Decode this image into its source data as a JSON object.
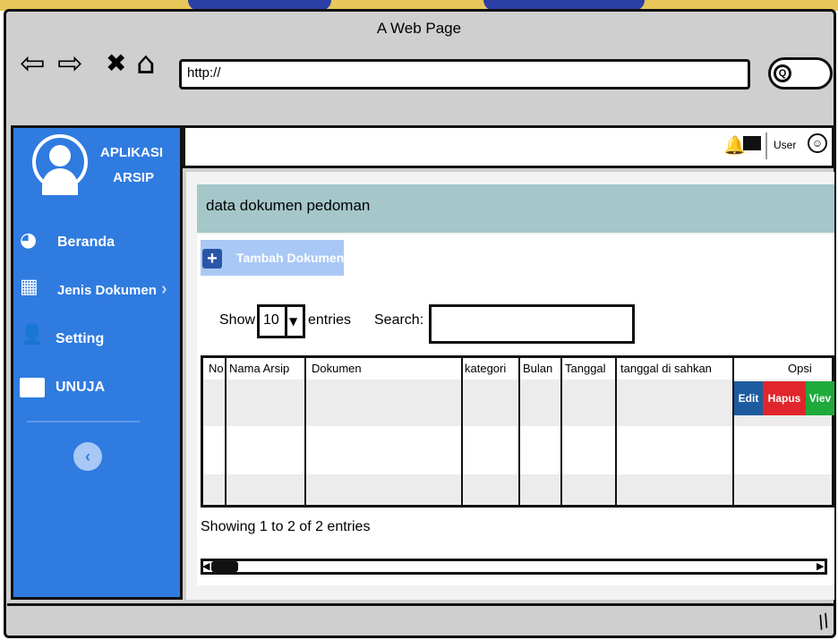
{
  "window": {
    "title": "A Web Page",
    "url": "http://",
    "nav_back": "⇦",
    "nav_forward": "⇨",
    "nav_stop": "✖",
    "nav_home": "⌂",
    "search_glyph": "Q"
  },
  "sidebar": {
    "brand_line1": "APLIKASI",
    "brand_line2": "ARSIP",
    "items": [
      {
        "label": "Beranda",
        "icon": "dashboard-icon",
        "glyph": "◕"
      },
      {
        "label": "Jenis Dokumen",
        "icon": "grid-icon",
        "glyph": "▦",
        "chevron": "›"
      },
      {
        "label": "Setting",
        "icon": "user-icon",
        "glyph": "👤"
      },
      {
        "label": "UNUJA",
        "icon": "folder-icon",
        "glyph": "▬"
      }
    ],
    "collapse_glyph": "‹"
  },
  "topbar": {
    "bell_glyph": "🔔",
    "user_label": "User",
    "user_glyph": "☺"
  },
  "panel": {
    "title": "data dokumen pedoman",
    "add_button": "Tambah Dokumen",
    "add_glyph": "+"
  },
  "table_controls": {
    "show_label": "Show",
    "page_size": "10",
    "caret": "▼",
    "entries_label": "entries",
    "search_label": "Search:"
  },
  "table": {
    "columns": [
      "No",
      "Nama Arsip",
      "Dokumen",
      "kategori",
      "Bulan",
      "Tanggal",
      "tanggal di sahkan",
      "Opsi"
    ],
    "actions": {
      "edit": "Edit",
      "hapus": "Hapus",
      "view": "Viev"
    }
  },
  "footer": {
    "showing": "Showing 1 to 2 of 2 entries",
    "scroll_left": "◀",
    "scroll_right": "▶"
  },
  "colors": {
    "sidebar": "#2f7be0",
    "panel_header": "#a5c7c9",
    "edit": "#1d5ba0",
    "hapus": "#e0262c",
    "view": "#1faa3c"
  }
}
